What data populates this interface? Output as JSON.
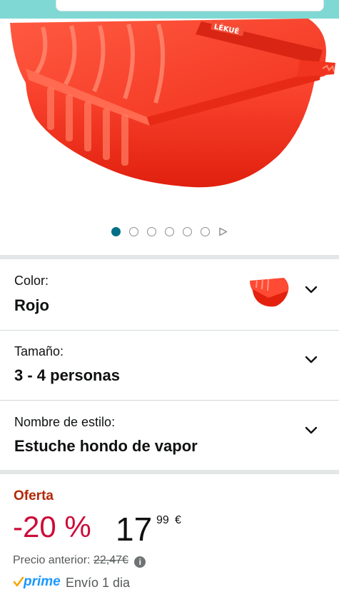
{
  "product": {
    "image_alt": "Lékué estuche hondo de vapor rojo",
    "brand_mark": "LÉKUÉ",
    "image_count": 6,
    "active_image": 1
  },
  "variations": [
    {
      "label": "Color:",
      "value": "Rojo",
      "has_thumbnail": true
    },
    {
      "label": "Tamaño:",
      "value": "3 - 4 personas",
      "has_thumbnail": false
    },
    {
      "label": "Nombre de estilo:",
      "value": "Estuche hondo de vapor",
      "has_thumbnail": false
    }
  ],
  "offer": {
    "deal_label": "Oferta",
    "discount": "-20 %",
    "price_whole": "17",
    "price_fraction": "99",
    "currency": "€",
    "previous_price_label": "Precio anterior:",
    "previous_price": "22,47€",
    "info_icon": "i"
  },
  "prime": {
    "label": "prime",
    "shipping": "Envío 1 dia"
  },
  "colors": {
    "accent": "#007185",
    "deal": "#b12704",
    "discount": "#cc0c39",
    "prime": "#1a98ff",
    "product_red": "#f22f1c"
  }
}
